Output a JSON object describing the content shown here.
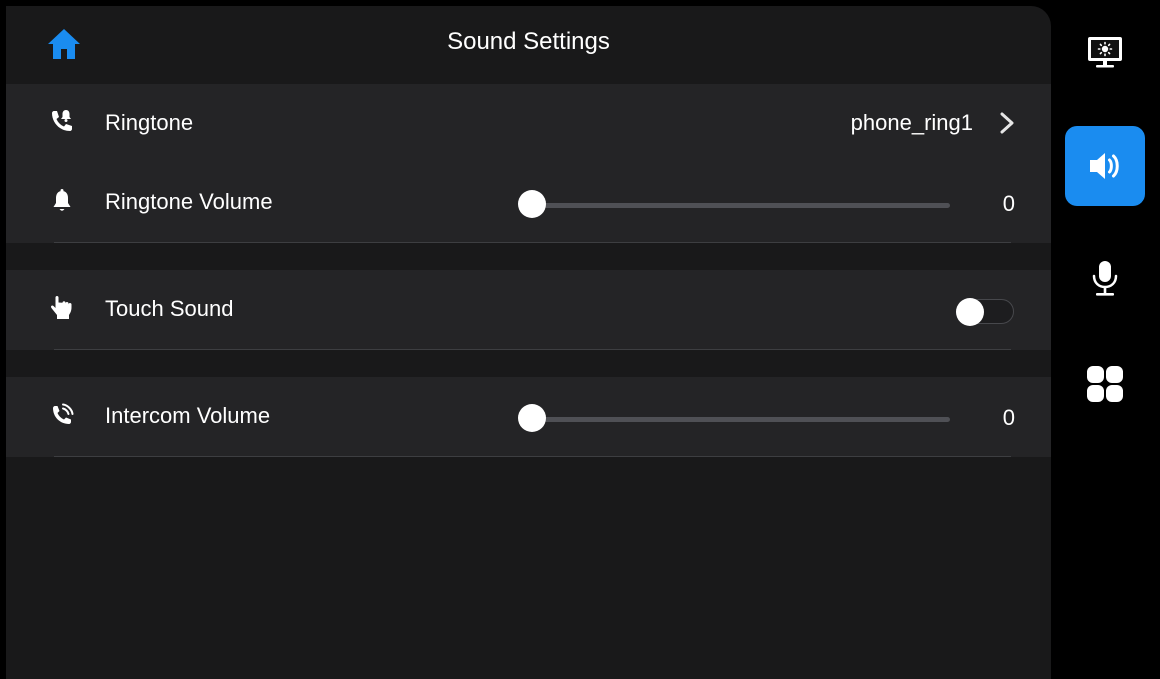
{
  "header": {
    "title": "Sound Settings",
    "home_icon": "home-icon",
    "home_color": "#1a8cf0"
  },
  "rows": {
    "ringtone": {
      "label": "Ringtone",
      "value": "phone_ring1",
      "icon": "phone-bell-icon"
    },
    "ringtone_volume": {
      "label": "Ringtone Volume",
      "value": "0",
      "level": 0,
      "icon": "bell-icon"
    },
    "touch_sound": {
      "label": "Touch Sound",
      "enabled": false,
      "icon": "hand-pointer-icon"
    },
    "intercom_volume": {
      "label": "Intercom Volume",
      "value": "0",
      "level": 0,
      "icon": "phone-call-icon"
    }
  },
  "sidebar": {
    "active": "sound",
    "accent": "#1a8cf0",
    "items": [
      {
        "id": "display",
        "icon": "monitor-brightness-icon"
      },
      {
        "id": "sound",
        "icon": "speaker-volume-icon"
      },
      {
        "id": "microphone",
        "icon": "microphone-icon"
      },
      {
        "id": "more",
        "icon": "grid-icon"
      }
    ]
  }
}
